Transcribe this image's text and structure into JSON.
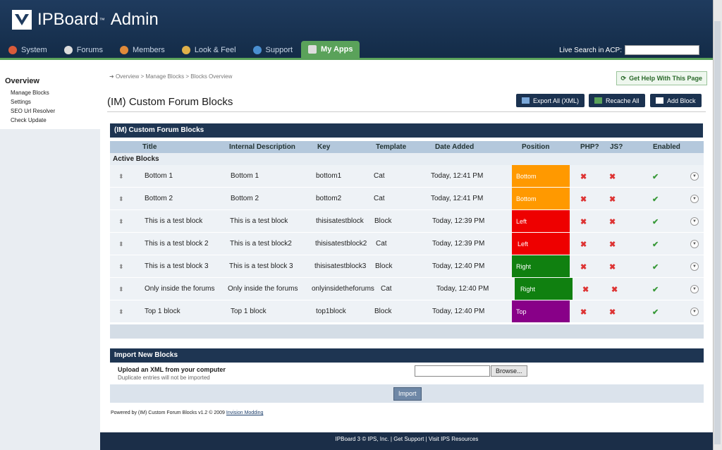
{
  "header": {
    "logo_text": "IPBoard",
    "logo_sup": "™",
    "logo_suffix": "Admin",
    "live_search_label": "Live Search in ACP:"
  },
  "nav": {
    "tabs": [
      {
        "label": "System",
        "icon": "system-icon"
      },
      {
        "label": "Forums",
        "icon": "forums-icon"
      },
      {
        "label": "Members",
        "icon": "members-icon"
      },
      {
        "label": "Look & Feel",
        "icon": "look-feel-icon"
      },
      {
        "label": "Support",
        "icon": "support-icon"
      },
      {
        "label": "My Apps",
        "icon": "myapps-icon",
        "active": true
      }
    ]
  },
  "sidebar": {
    "title": "Overview",
    "items": [
      "Manage Blocks",
      "Settings",
      "SEO Url Resolver",
      "Check Update"
    ]
  },
  "breadcrumb": [
    "Overview",
    "Manage Blocks",
    "Blocks Overview"
  ],
  "help_button": "Get Help With This Page",
  "page_title": "(IM) Custom Forum Blocks",
  "toolbar": {
    "export": "Export All (XML)",
    "recache": "Recache All",
    "add": "Add Block"
  },
  "blocks_panel": {
    "title": "(IM) Custom Forum Blocks",
    "columns": [
      "Title",
      "Internal Description",
      "Key",
      "Template",
      "Date Added",
      "Position",
      "PHP?",
      "JS?",
      "Enabled"
    ],
    "group_label": "Active Blocks",
    "rows": [
      {
        "title": "Bottom 1",
        "desc": "Bottom 1",
        "key": "bottom1",
        "template": "Cat",
        "date": "Today, 12:41 PM",
        "position": "Bottom",
        "pos_color": "#ff9900"
      },
      {
        "title": "Bottom 2",
        "desc": "Bottom 2",
        "key": "bottom2",
        "template": "Cat",
        "date": "Today, 12:41 PM",
        "position": "Bottom",
        "pos_color": "#ff9900"
      },
      {
        "title": "This is a test block",
        "desc": "This is a test block",
        "key": "thisisatestblock",
        "template": "Block",
        "date": "Today, 12:39 PM",
        "position": "Left",
        "pos_color": "#ee0000"
      },
      {
        "title": "This is a test block 2",
        "desc": "This is a test block2",
        "key": "thisisatestblock2",
        "template": "Cat",
        "date": "Today, 12:39 PM",
        "position": "Left",
        "pos_color": "#ee0000"
      },
      {
        "title": "This is a test block 3",
        "desc": "This is a test block 3",
        "key": "thisisatestblock3",
        "template": "Block",
        "date": "Today, 12:40 PM",
        "position": "Right",
        "pos_color": "#108010"
      },
      {
        "title": "Only inside the forums",
        "desc": "Only inside the forums",
        "key": "onlyinsidetheforums",
        "template": "Cat",
        "date": "Today, 12:40 PM",
        "position": "Right",
        "pos_color": "#108010"
      },
      {
        "title": "Top 1 block",
        "desc": "Top 1 block",
        "key": "top1block",
        "template": "Block",
        "date": "Today, 12:40 PM",
        "position": "Top",
        "pos_color": "#880088"
      }
    ],
    "php_mark": "✖",
    "js_mark": "✖",
    "enabled_mark": "✔"
  },
  "import_panel": {
    "title": "Import New Blocks",
    "label": "Upload an XML from your computer",
    "sublabel": "Duplicate entries will not be imported",
    "browse": "Browse...",
    "submit": "Import"
  },
  "powered": {
    "text": "Powered by (IM) Custom Forum Blocks v1.2 © 2009",
    "link": "Invision Modding"
  },
  "footer": {
    "text": "IPBoard 3 © IPS, Inc.   |   Get Support   |   Visit IPS Resources"
  }
}
